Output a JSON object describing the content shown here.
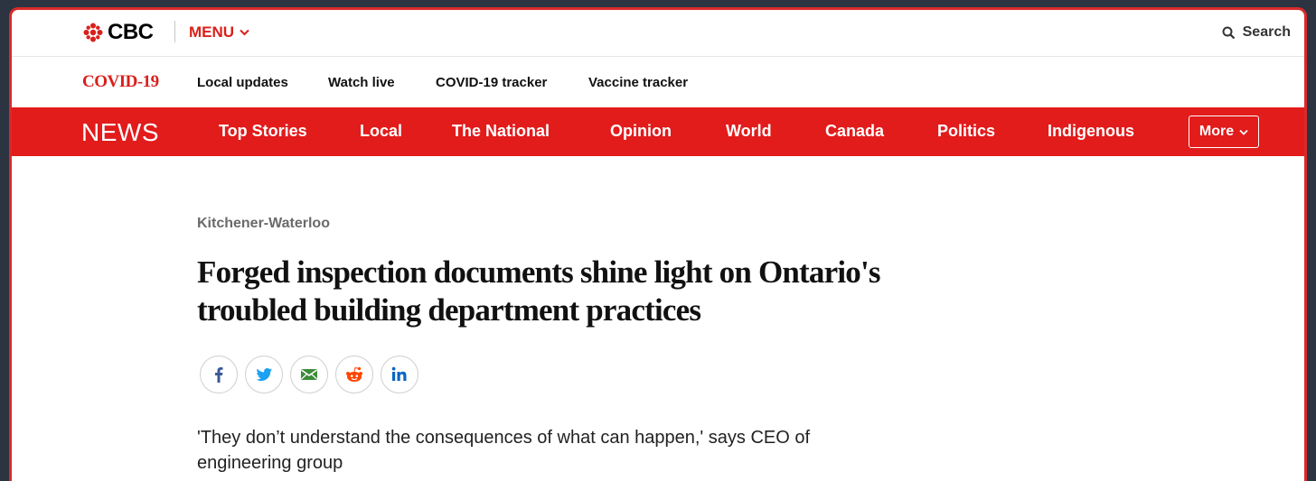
{
  "brand": {
    "logo_text": "CBC",
    "accent": "#e21b1b",
    "menu_label": "MENU",
    "search_label": "Search"
  },
  "covid_bar": {
    "label": "COVID-19",
    "links": [
      "Local updates",
      "Watch live",
      "COVID-19 tracker",
      "Vaccine tracker"
    ]
  },
  "news_nav": {
    "label": "NEWS",
    "items": [
      "Top Stories",
      "Local",
      "The National",
      "Opinion",
      "World",
      "Canada",
      "Politics",
      "Indigenous"
    ],
    "more_label": "More"
  },
  "article": {
    "section": "Kitchener-Waterloo",
    "headline": "Forged inspection documents shine light on Ontario's troubled building department practices",
    "share_icons": [
      "facebook-icon",
      "twitter-icon",
      "email-icon",
      "reddit-icon",
      "linkedin-icon"
    ],
    "deck": "'They don’t understand the consequences of what can happen,' says CEO of engineering group"
  }
}
